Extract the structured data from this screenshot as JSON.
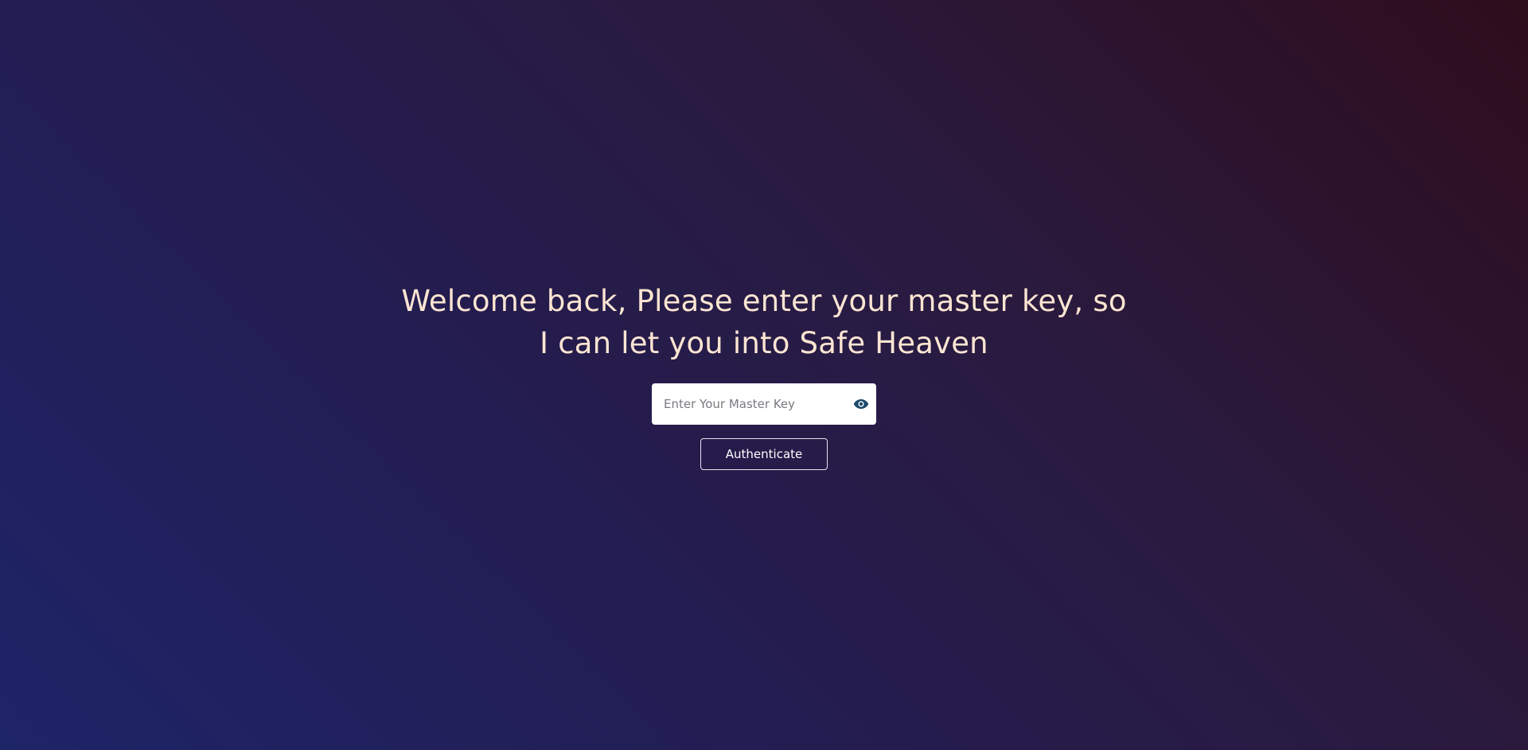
{
  "login": {
    "heading": "Welcome back, Please enter your master key, so I can let you into Safe Heaven",
    "master_key_placeholder": "Enter Your Master Key",
    "master_key_value": "",
    "toggle_visibility_icon": "eye-icon",
    "authenticate_label": "Authenticate"
  },
  "colors": {
    "heading_text": "#fde5d2",
    "eye_icon": "#1b4a6b",
    "gradient_start": "#1e2468",
    "gradient_end": "#2e0d1c",
    "button_border": "#e8e3ee"
  }
}
